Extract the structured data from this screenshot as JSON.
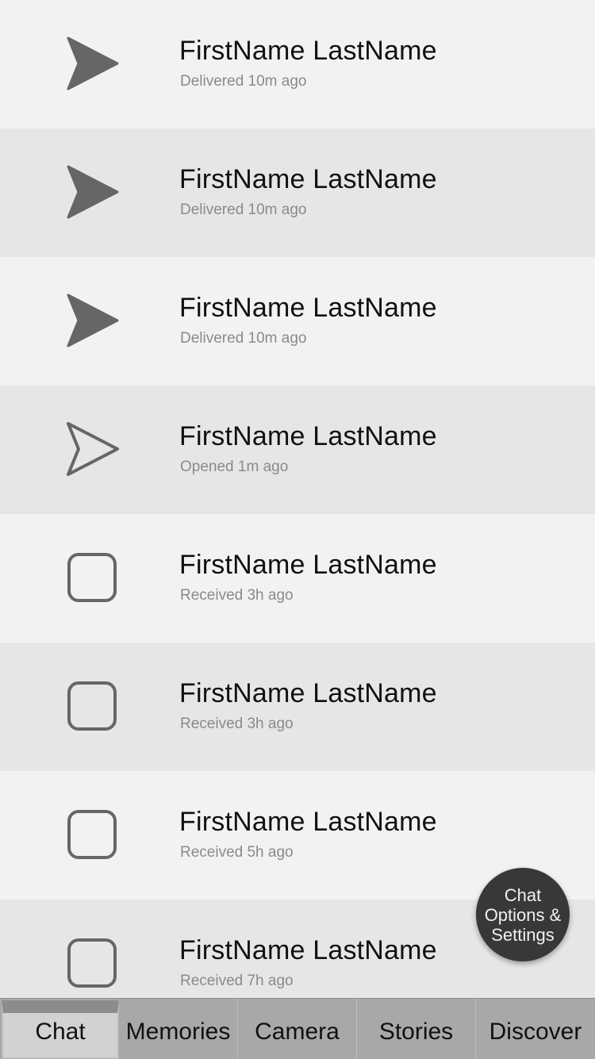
{
  "chats": [
    {
      "name": "FirstName LastName",
      "status": "Delivered 10m ago",
      "icon": "filled-arrow-icon"
    },
    {
      "name": "FirstName LastName",
      "status": "Delivered 10m ago",
      "icon": "filled-arrow-icon"
    },
    {
      "name": "FirstName LastName",
      "status": "Delivered 10m ago",
      "icon": "filled-arrow-icon"
    },
    {
      "name": "FirstName LastName",
      "status": "Opened 1m ago",
      "icon": "outline-arrow-icon"
    },
    {
      "name": "FirstName LastName",
      "status": "Received 3h ago",
      "icon": "rounded-square-icon"
    },
    {
      "name": "FirstName LastName",
      "status": "Received 3h ago",
      "icon": "rounded-square-icon"
    },
    {
      "name": "FirstName LastName",
      "status": "Received 5h ago",
      "icon": "rounded-square-icon"
    },
    {
      "name": "FirstName LastName",
      "status": "Received 7h ago",
      "icon": "rounded-square-icon"
    }
  ],
  "fab": {
    "label_line1": "Chat",
    "label_line2": "Options &",
    "label_line3": "Settings"
  },
  "tabs": [
    {
      "label": "Chat",
      "active": true
    },
    {
      "label": "Memories",
      "active": false
    },
    {
      "label": "Camera",
      "active": false
    },
    {
      "label": "Stories",
      "active": false
    },
    {
      "label": "Discover",
      "active": false
    }
  ],
  "colors": {
    "row_light": "#f2f2f2",
    "row_dark": "#e6e6e6",
    "icon": "#666666",
    "fab": "#383838",
    "tabbar": "#a8a8a8"
  }
}
